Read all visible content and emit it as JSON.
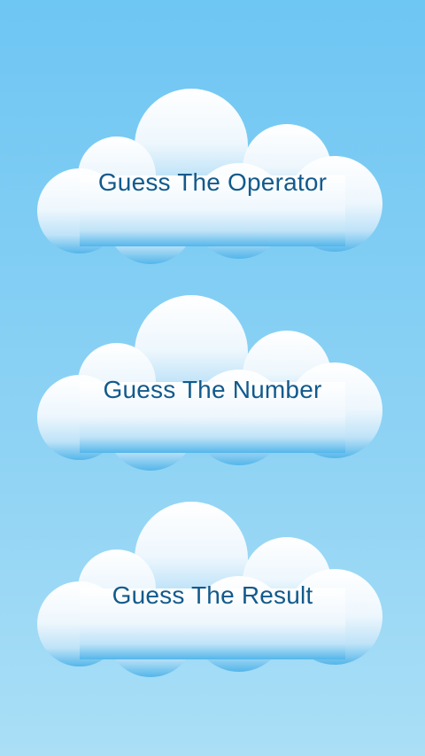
{
  "menu": {
    "items": [
      {
        "label": "Guess The Operator"
      },
      {
        "label": "Guess The Number"
      },
      {
        "label": "Guess The Result"
      }
    ]
  },
  "colors": {
    "background_top": "#6ec6f3",
    "background_bottom": "#aadff6",
    "cloud_top": "#ffffff",
    "cloud_bottom": "#54b6ea",
    "label_text": "#125a8c"
  }
}
